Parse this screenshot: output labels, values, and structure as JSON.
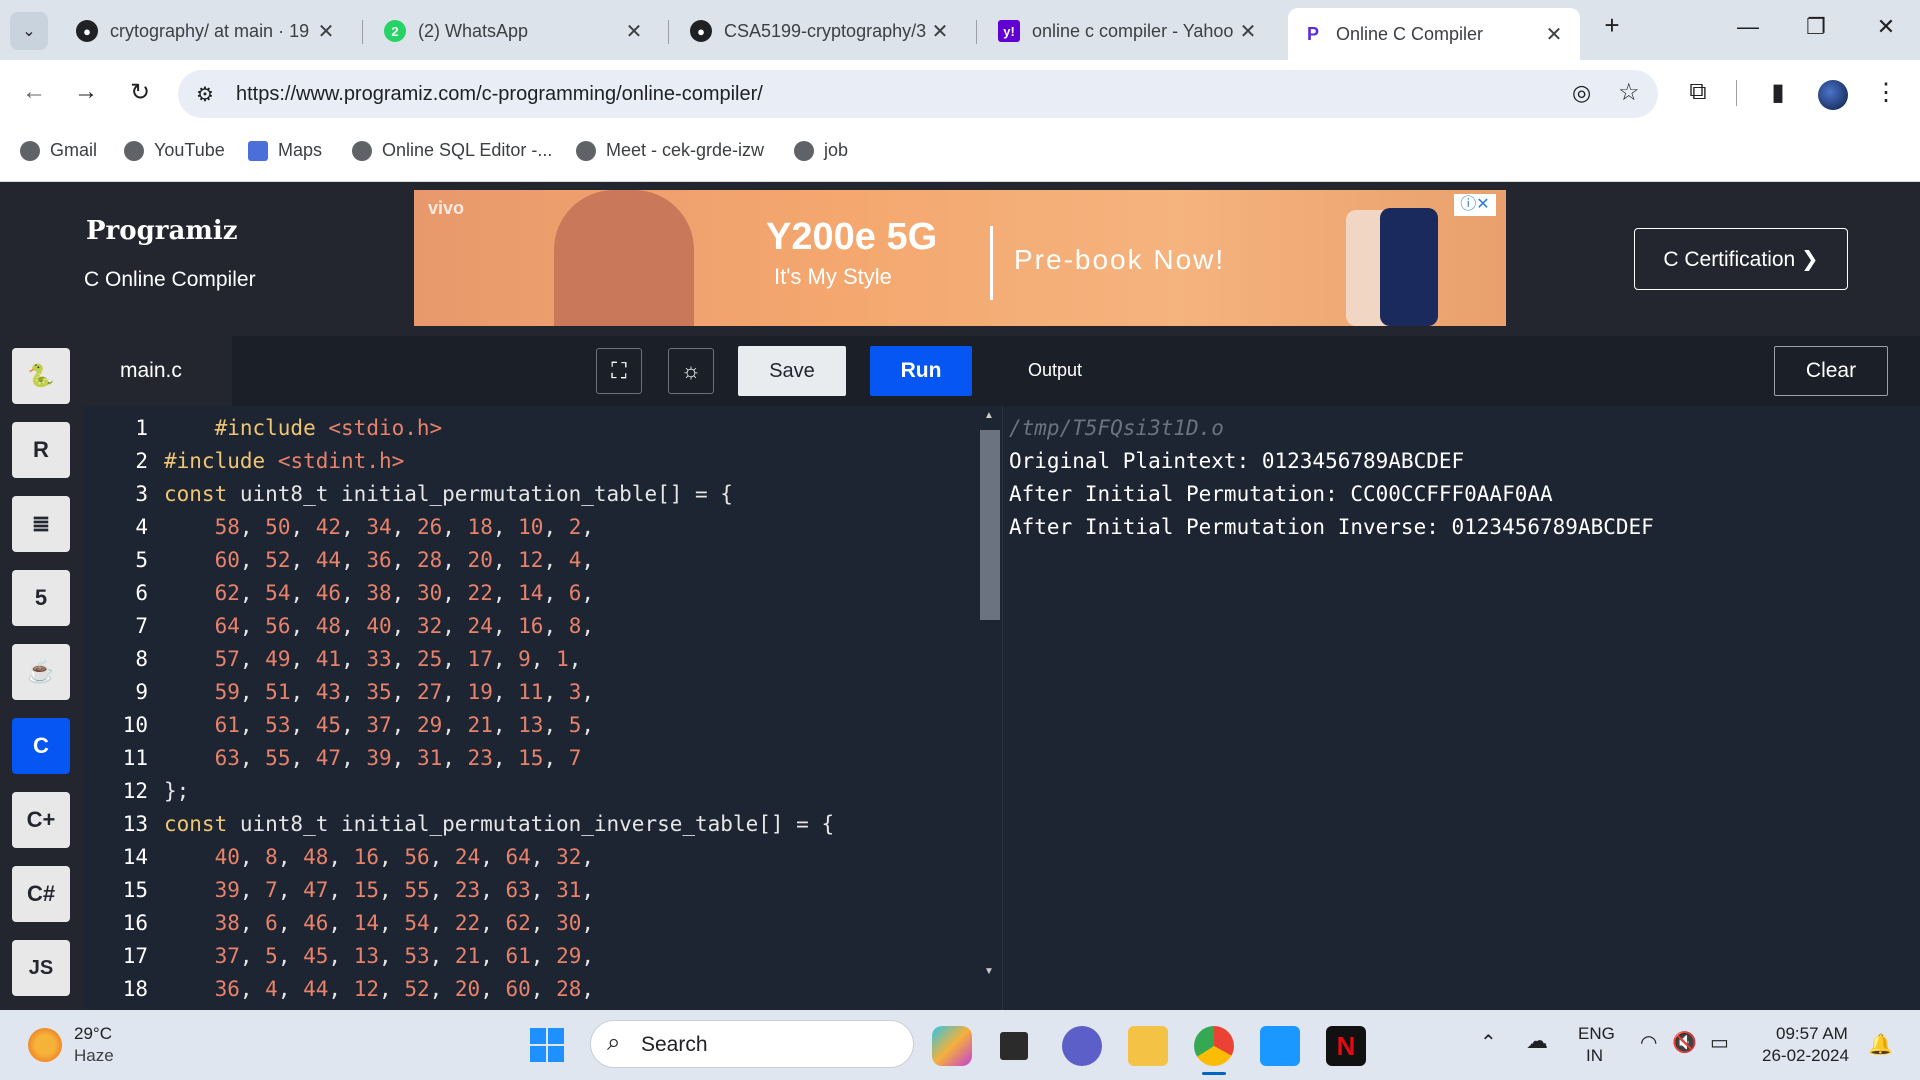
{
  "browser": {
    "tabs": [
      {
        "title": "crytography/ at main · 19",
        "icon": "github-icon"
      },
      {
        "title": "(2) WhatsApp",
        "icon": "whatsapp-icon",
        "badge": "2"
      },
      {
        "title": "CSA5199-cryptography/3",
        "icon": "github-icon"
      },
      {
        "title": "online c compiler - Yahoo",
        "icon": "yahoo-icon"
      },
      {
        "title": "Online C Compiler",
        "icon": "programiz-icon",
        "active": true
      }
    ],
    "new_tab": "+",
    "url": "https://www.programiz.com/c-programming/online-compiler/",
    "bookmarks": [
      "Gmail",
      "YouTube",
      "Maps",
      "Online SQL Editor -...",
      "Meet - cek-grde-izw",
      "job"
    ]
  },
  "header": {
    "logo": "Programiz",
    "subtitle": "C Online Compiler",
    "cert_button": "C Certification ❯",
    "ad": {
      "brand": "vivo",
      "model": "Y200e 5G",
      "tagline": "It's My Style",
      "cta": "Pre-book Now!"
    }
  },
  "sidebar": {
    "languages": [
      "python",
      "r",
      "sql",
      "html",
      "java",
      "c",
      "cpp",
      "csharp",
      "js"
    ],
    "selected": "c",
    "js_label": "JS"
  },
  "editor": {
    "filename": "main.c",
    "save_label": "Save",
    "run_label": "Run",
    "lines": [
      {
        "n": "1",
        "text": "    #include <stdio.h>"
      },
      {
        "n": "2",
        "text": "#include <stdint.h>"
      },
      {
        "n": "3",
        "text": "const uint8_t initial_permutation_table[] = {"
      },
      {
        "n": "4",
        "text": "    58, 50, 42, 34, 26, 18, 10, 2,"
      },
      {
        "n": "5",
        "text": "    60, 52, 44, 36, 28, 20, 12, 4,"
      },
      {
        "n": "6",
        "text": "    62, 54, 46, 38, 30, 22, 14, 6,"
      },
      {
        "n": "7",
        "text": "    64, 56, 48, 40, 32, 24, 16, 8,"
      },
      {
        "n": "8",
        "text": "    57, 49, 41, 33, 25, 17, 9, 1,"
      },
      {
        "n": "9",
        "text": "    59, 51, 43, 35, 27, 19, 11, 3,"
      },
      {
        "n": "10",
        "text": "    61, 53, 45, 37, 29, 21, 13, 5,"
      },
      {
        "n": "11",
        "text": "    63, 55, 47, 39, 31, 23, 15, 7"
      },
      {
        "n": "12",
        "text": "};"
      },
      {
        "n": "13",
        "text": "const uint8_t initial_permutation_inverse_table[] = {"
      },
      {
        "n": "14",
        "text": "    40, 8, 48, 16, 56, 24, 64, 32,"
      },
      {
        "n": "15",
        "text": "    39, 7, 47, 15, 55, 23, 63, 31,"
      },
      {
        "n": "16",
        "text": "    38, 6, 46, 14, 54, 22, 62, 30,"
      },
      {
        "n": "17",
        "text": "    37, 5, 45, 13, 53, 21, 61, 29,"
      },
      {
        "n": "18",
        "text": "    36, 4, 44, 12, 52, 20, 60, 28,"
      }
    ]
  },
  "output": {
    "label": "Output",
    "clear_label": "Clear",
    "lines": [
      "/tmp/T5FQsi3t1D.o",
      "Original Plaintext: 0123456789ABCDEF",
      "After Initial Permutation: CC00CCFFF0AAF0AA",
      "After Initial Permutation Inverse: 0123456789ABCDEF"
    ]
  },
  "taskbar": {
    "weather_temp": "29°C",
    "weather_desc": "Haze",
    "search_placeholder": "Search",
    "lang_top": "ENG",
    "lang_bottom": "IN",
    "time": "09:57 AM",
    "date": "26-02-2024"
  },
  "colors": {
    "accent": "#0556f3",
    "editor_bg": "#1e2532",
    "header_bg": "#23262e"
  }
}
